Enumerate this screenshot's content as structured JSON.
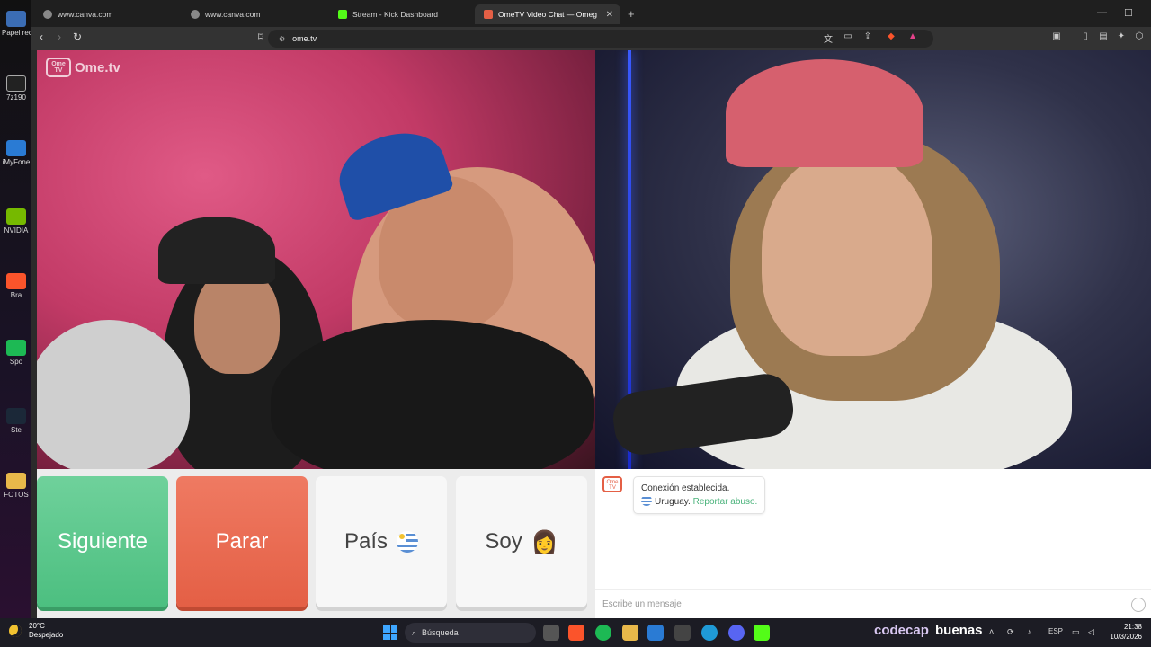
{
  "browser": {
    "tabs": [
      {
        "label": "www.canva.com",
        "active": false
      },
      {
        "label": "www.canva.com",
        "active": false
      },
      {
        "label": "Stream - Kick Dashboard",
        "active": false
      },
      {
        "label": "OmeTV Video Chat — Omeg",
        "active": true
      }
    ],
    "url": "ome.tv"
  },
  "desktop": {
    "icons": [
      "Papel recic",
      "7z190",
      "iMyFone",
      "NVIDIA",
      "Bra",
      "Spo",
      "Ste",
      "FOTOS"
    ]
  },
  "ometv": {
    "logo_text": "Ome.tv",
    "logo_box_text": "Ome TV",
    "buttons": {
      "next": "Siguiente",
      "stop": "Parar",
      "country": "País",
      "gender": "Soy"
    },
    "chat": {
      "status": "Conexión establecida.",
      "country": "Uruguay.",
      "report": "Reportar abuso.",
      "input_placeholder": "Escribe un mensaje"
    }
  },
  "taskbar": {
    "weather_temp": "20°C",
    "weather_desc": "Despejado",
    "search_label": "Búsqueda",
    "brand_1": "codecap",
    "brand_2": "buenas",
    "language": "ESP",
    "time": "21:38",
    "date": "10/3/2026"
  },
  "colors": {
    "next": "#4cbf80",
    "stop": "#e45f45",
    "accent_link": "#49b27a"
  }
}
